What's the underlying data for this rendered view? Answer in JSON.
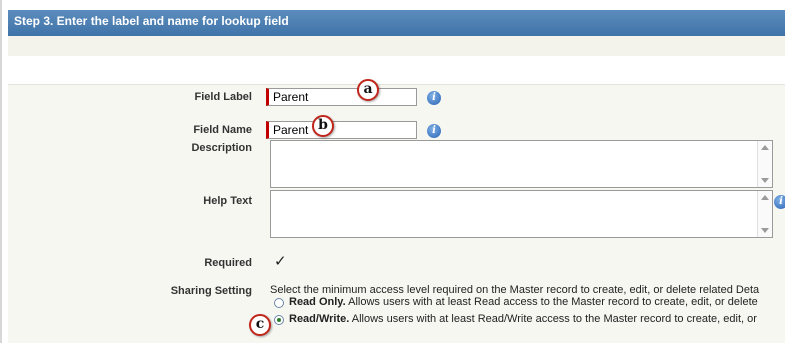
{
  "header": {
    "title": "Step 3. Enter the label and name for lookup field"
  },
  "form": {
    "field_label": {
      "label": "Field Label",
      "value": "Parent"
    },
    "field_name": {
      "label": "Field Name",
      "value": "Parent"
    },
    "description": {
      "label": "Description"
    },
    "help_text": {
      "label": "Help Text"
    },
    "required": {
      "label": "Required",
      "check": "✓"
    },
    "sharing": {
      "label": "Sharing Setting",
      "intro": "Select the minimum access level required on the Master record to create, edit, or delete related Deta",
      "options": [
        {
          "bold": "Read Only.",
          "text": " Allows users with at least Read access to the Master record to create, edit, or delete",
          "selected": false
        },
        {
          "bold": "Read/Write.",
          "text": " Allows users with at least Read/Write access to the Master record to create, edit, or",
          "selected": true
        }
      ]
    }
  },
  "callouts": {
    "a": "a",
    "b": "b",
    "c": "c"
  },
  "icons": {
    "info": "i"
  },
  "colors": {
    "header": "#4a7fb1",
    "required_bar": "#c00000",
    "callout_border": "#c0261b"
  }
}
